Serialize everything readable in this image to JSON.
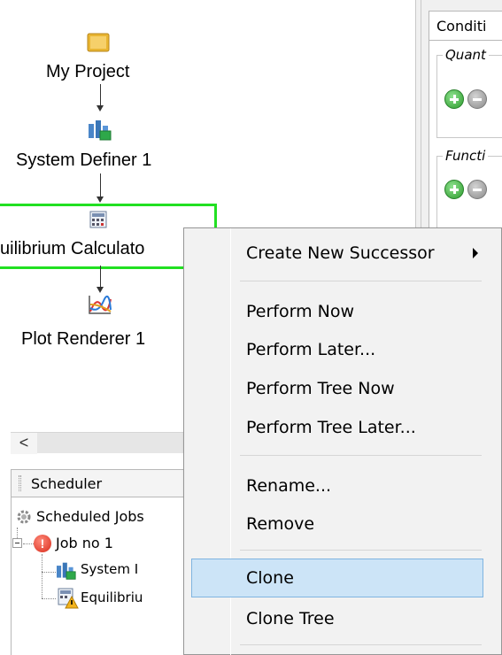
{
  "tree": {
    "nodes": [
      {
        "label": "My Project",
        "icon": "project-folder-icon"
      },
      {
        "label": "System Definer 1",
        "icon": "system-definer-icon"
      },
      {
        "label": "uilibrium Calculato",
        "icon": "calculator-icon"
      },
      {
        "label": "Plot Renderer 1",
        "icon": "plot-renderer-icon"
      }
    ],
    "selected_border_color": "#22e022"
  },
  "right_panel": {
    "tab_label": "Conditi",
    "groups": [
      {
        "title": "Quant"
      },
      {
        "title": "Functi"
      }
    ]
  },
  "scrollbar": {
    "left_arrow": "<"
  },
  "scheduler": {
    "tab_label": "Scheduler",
    "root": "Scheduled Jobs",
    "job": "Job no 1",
    "children": [
      "System I",
      "Equilibriu"
    ]
  },
  "context_menu": {
    "items": [
      {
        "label": "Create New Successor",
        "submenu": true
      },
      {
        "label": "Perform Now"
      },
      {
        "label": "Perform Later..."
      },
      {
        "label": "Perform Tree Now"
      },
      {
        "label": "Perform Tree Later..."
      },
      {
        "label": "Rename..."
      },
      {
        "label": "Remove"
      },
      {
        "label": "Clone",
        "highlighted": true
      },
      {
        "label": "Clone Tree"
      }
    ],
    "highlight_color": "#cce4f7"
  }
}
